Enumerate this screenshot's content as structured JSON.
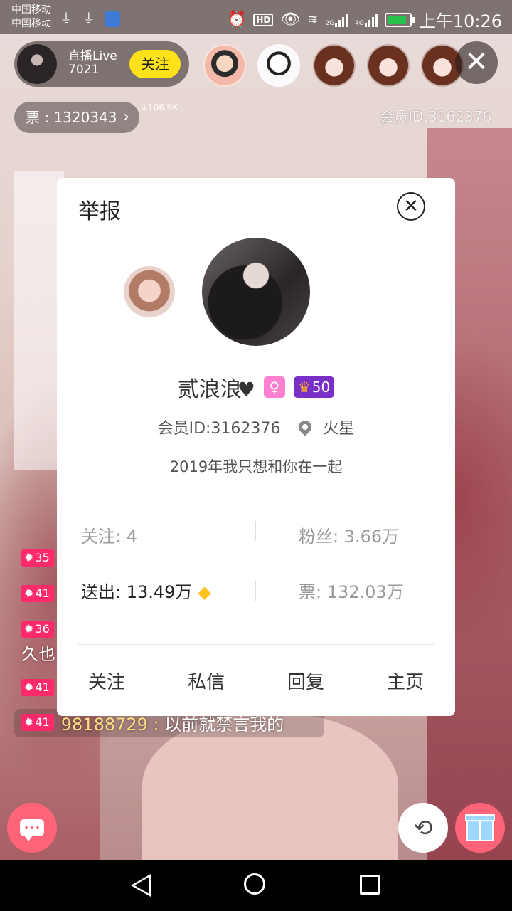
{
  "status_bar": {
    "carrier_1": "中国移动",
    "carrier_2": "中国移动",
    "network_1": "2G",
    "network_2": "4G",
    "time": "上午10:26",
    "hd_label": "HD"
  },
  "live": {
    "host_name": "直播Live",
    "host_id": "7021",
    "follow_label": "关注",
    "close_symbol": "✕",
    "tickets": "票 : 1320343",
    "tickets_chevron": "›",
    "net_speed": "↓106.9K",
    "member_id": "会员ID:3162376"
  },
  "chat": [
    {
      "level": "35",
      "text": ""
    },
    {
      "level": "41",
      "text": ""
    },
    {
      "level": "36",
      "text": ""
    },
    {
      "level": "",
      "text": "久也"
    },
    {
      "level": "41",
      "text": ""
    },
    {
      "level": "41",
      "nick": "98188729 : ",
      "text": "以前就禁言我的"
    }
  ],
  "dialog": {
    "title": "举报",
    "close_symbol": "✕",
    "name": "贰浪浪",
    "heart": "♥",
    "gender_symbol": "♀",
    "level_crown": "♛",
    "level": "50",
    "member_id": "会员ID:3162376",
    "location": "火星",
    "signature": "2019年我只想和你在一起",
    "stats": {
      "following": "关注: 4",
      "fans": "粉丝: 3.66万",
      "sent": "送出: 13.49万",
      "sent_gem": "◆",
      "tickets": "票: 132.03万"
    },
    "actions": [
      "关注",
      "私信",
      "回复",
      "主页"
    ]
  },
  "bottom": {
    "share_symbol": "⟲"
  },
  "colors": {
    "follow_yellow": "#ffe21a",
    "level_pink": "#ff2a6a",
    "chat_button": "#ff6478",
    "level_badge_purple": "#7a2fc9",
    "gender_badge_pink": "#ff7fd0"
  }
}
